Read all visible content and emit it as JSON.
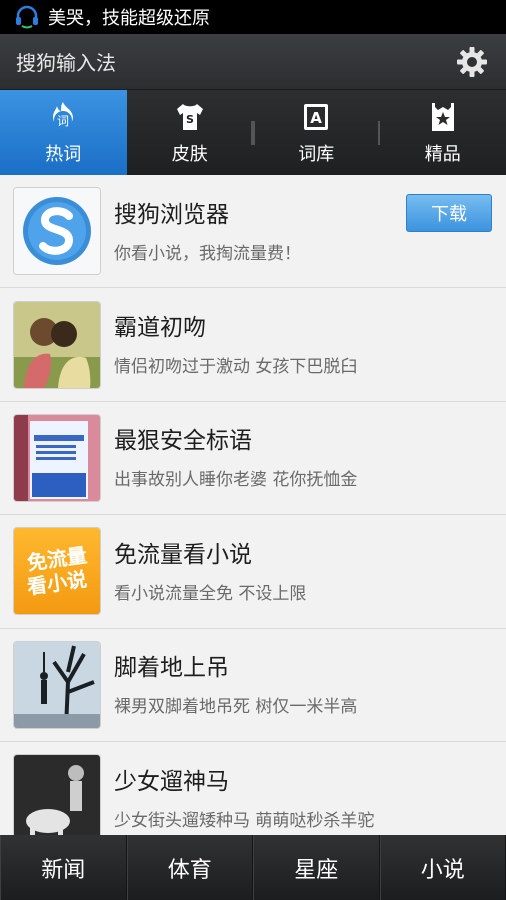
{
  "status_bar": {
    "notification": "美哭，技能超级还原"
  },
  "app": {
    "title": "搜狗输入法",
    "settings_icon": "gear-icon"
  },
  "tabs": [
    {
      "label": "热词",
      "icon": "hot-words-icon",
      "active": true
    },
    {
      "label": "皮肤",
      "icon": "skin-shirt-icon",
      "active": false
    },
    {
      "label": "词库",
      "icon": "dictionary-icon",
      "active": false
    },
    {
      "label": "精品",
      "icon": "featured-star-icon",
      "active": false
    }
  ],
  "list": [
    {
      "title": "搜狗浏览器",
      "subtitle": "你看小说，我掏流量费！",
      "button": "下载",
      "thumb": "sogou-browser-logo"
    },
    {
      "title": "霸道初吻",
      "subtitle": "情侣初吻过于激动 女孩下巴脱臼",
      "thumb": "couple-kiss-photo"
    },
    {
      "title": "最狠安全标语",
      "subtitle": "出事故别人睡你老婆 花你抚恤金",
      "thumb": "safety-slogan-photo"
    },
    {
      "title": "免流量看小说",
      "subtitle": "看小说流量全免 不设上限",
      "thumb": "free-traffic-novel-badge",
      "thumb_text": [
        "免流量",
        "看小说"
      ]
    },
    {
      "title": "脚着地上吊",
      "subtitle": "裸男双脚着地吊死 树仅一米半高",
      "thumb": "tree-hanging-photo"
    },
    {
      "title": "少女遛神马",
      "subtitle": "少女街头遛矮种马  萌萌哒秒杀羊驼",
      "thumb": "girl-pony-photo"
    }
  ],
  "bottom_nav": [
    "新闻",
    "体育",
    "星座",
    "小说"
  ],
  "colors": {
    "accent": "#2a86d8",
    "button": "#4a9fe6",
    "list_bg": "#f1f2f1"
  }
}
